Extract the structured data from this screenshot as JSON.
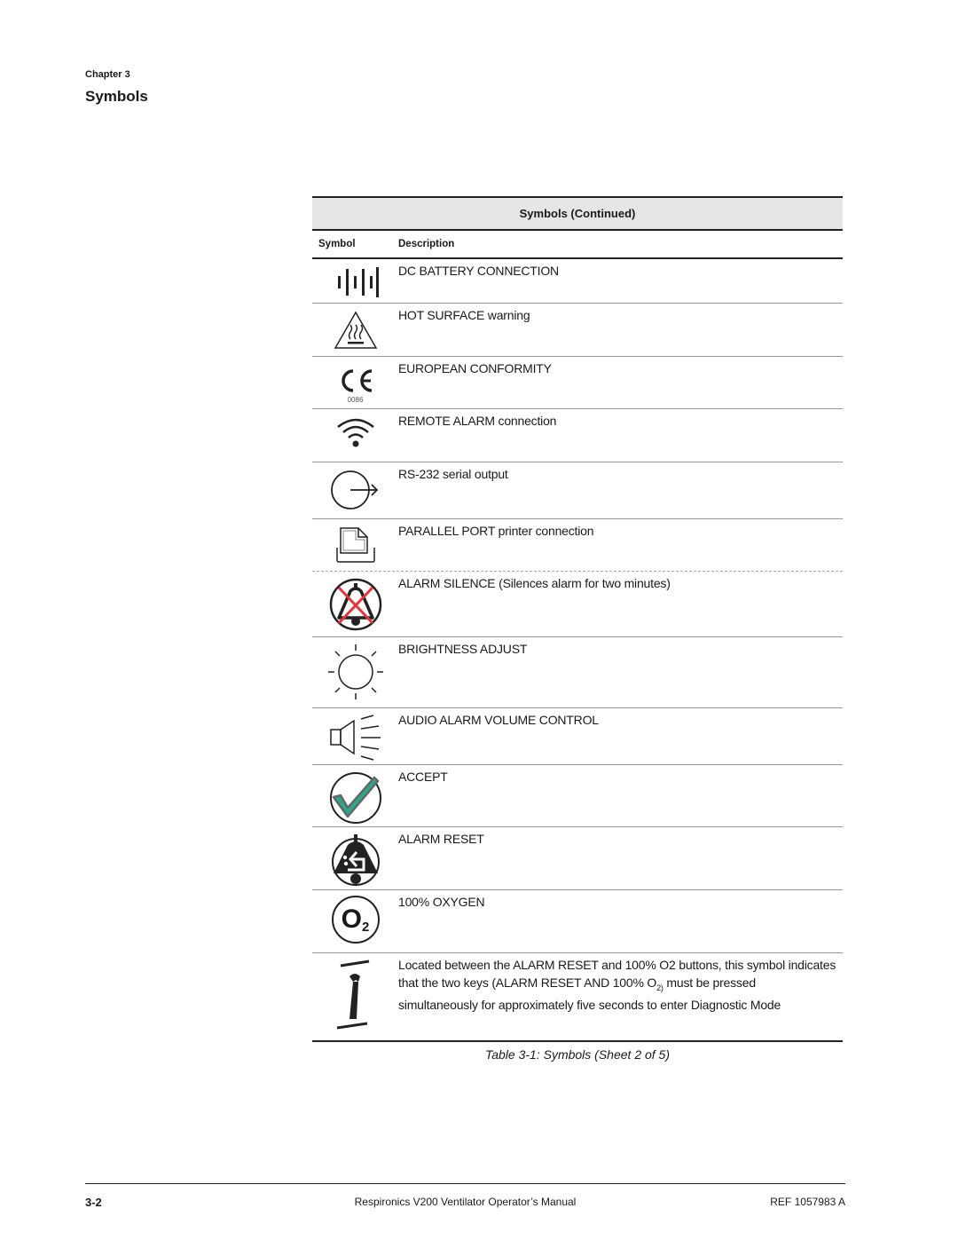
{
  "header": {
    "chapter": "Chapter 3",
    "title": "Symbols"
  },
  "table": {
    "title": "Symbols (Continued)",
    "columns": [
      "Symbol",
      "Description"
    ],
    "rows": [
      {
        "icon": "dc-battery-icon",
        "description": "DC BATTERY CONNECTION"
      },
      {
        "icon": "hot-surface-icon",
        "description": "HOT SURFACE warning"
      },
      {
        "icon": "ce-mark-icon",
        "description": "EUROPEAN CONFORMITY",
        "icon_text": "0086"
      },
      {
        "icon": "remote-alarm-icon",
        "description": "REMOTE ALARM connection"
      },
      {
        "icon": "serial-output-icon",
        "description": "RS-232 serial output"
      },
      {
        "icon": "parallel-port-printer-icon",
        "description": "PARALLEL PORT printer connection"
      },
      {
        "icon": "alarm-silence-icon",
        "description": "ALARM SILENCE (Silences alarm for two minutes)"
      },
      {
        "icon": "brightness-icon",
        "description": "BRIGHTNESS ADJUST"
      },
      {
        "icon": "volume-control-icon",
        "description": "AUDIO ALARM VOLUME CONTROL"
      },
      {
        "icon": "accept-check-icon",
        "description": "ACCEPT"
      },
      {
        "icon": "alarm-reset-icon",
        "description": "ALARM RESET"
      },
      {
        "icon": "oxygen-o2-icon",
        "description": "100% OXYGEN",
        "icon_text": "O",
        "icon_sub": "2"
      },
      {
        "icon": "diagnostic-wrench-icon",
        "description_pre": "Located between the ALARM RESET and 100% O2 buttons, this symbol indicates that the two keys (ALARM RESET AND 100% O",
        "description_sub": "2)",
        "description_post": " must be pressed simultaneously for approximately five seconds to enter Diagnostic Mode"
      }
    ]
  },
  "caption": "Table 3-1: Symbols (Sheet 2 of 5)",
  "footer": {
    "page": "3-2",
    "manual": "Respironics V200 Ventilator Operator’s Manual",
    "ref": "REF 1057983 A"
  },
  "colors": {
    "header_bg": "#e6e6e6",
    "silence_cross": "#e8333a",
    "accept_check": "#2aa88a"
  }
}
